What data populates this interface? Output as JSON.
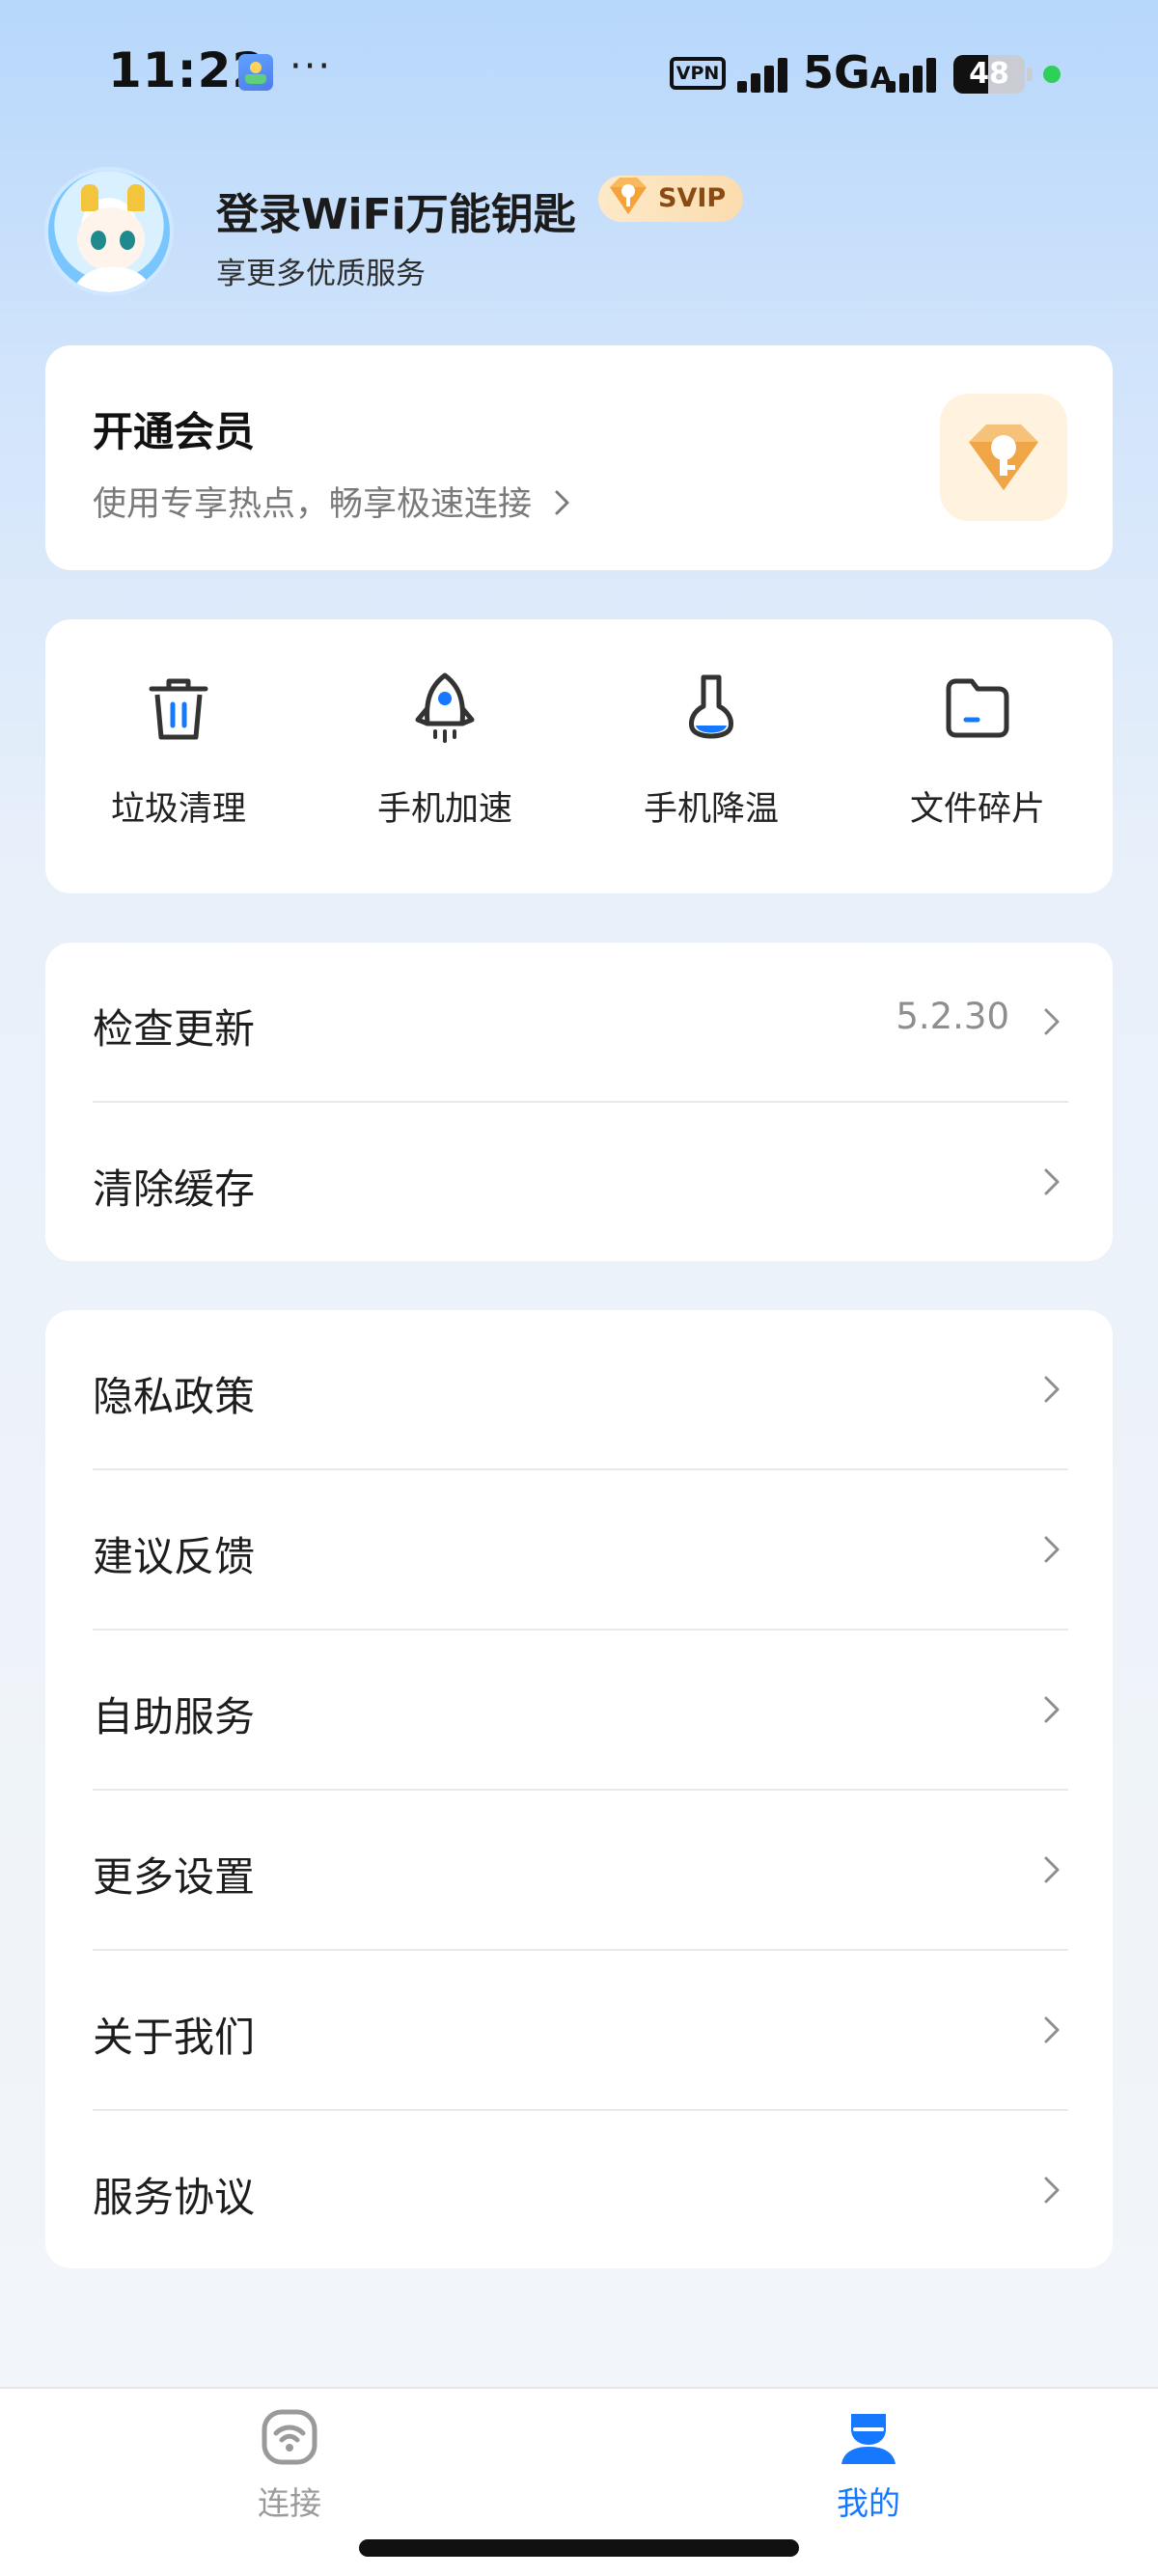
{
  "status_bar": {
    "time": "11:22",
    "more": "···",
    "vpn": "VPN",
    "network": "5G",
    "network_sub": "A",
    "battery": "48"
  },
  "profile": {
    "title": "登录WiFi万能钥匙",
    "badge": "SVIP",
    "subtitle": "享更多优质服务"
  },
  "vip_card": {
    "title": "开通会员",
    "description": "使用专享热点，畅享极速连接"
  },
  "tools": [
    {
      "label": "垃圾清理",
      "icon": "trash-icon"
    },
    {
      "label": "手机加速",
      "icon": "rocket-icon"
    },
    {
      "label": "手机降温",
      "icon": "thermometer-icon"
    },
    {
      "label": "文件碎片",
      "icon": "folder-icon"
    }
  ],
  "menu_group_1": [
    {
      "label": "检查更新",
      "value": "5.2.30"
    },
    {
      "label": "清除缓存"
    }
  ],
  "menu_group_2": [
    {
      "label": "隐私政策"
    },
    {
      "label": "建议反馈"
    },
    {
      "label": "自助服务"
    },
    {
      "label": "更多设置"
    },
    {
      "label": "关于我们"
    },
    {
      "label": "服务协议"
    }
  ],
  "tab_bar": {
    "connect": "连接",
    "mine": "我的",
    "active": "mine",
    "active_color": "#1677ff",
    "inactive_color": "#9a9a9a"
  }
}
